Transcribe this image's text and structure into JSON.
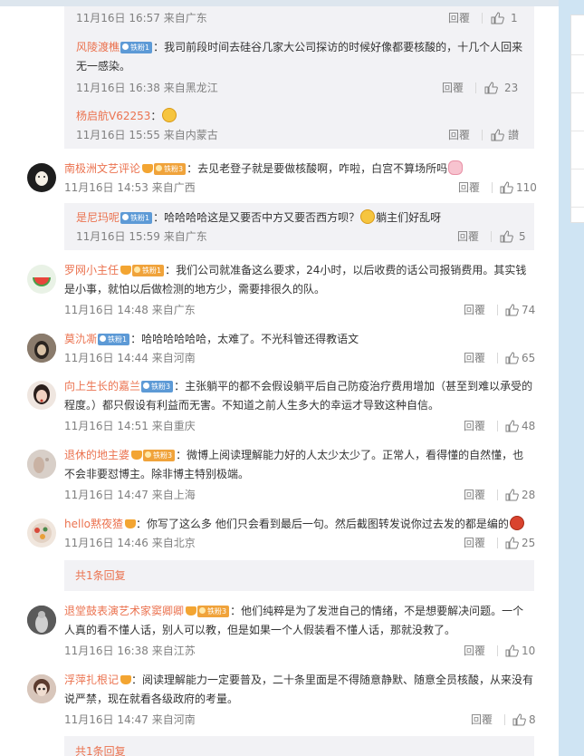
{
  "ui": {
    "reply_label": "回覆",
    "expand_label": "共1条回复",
    "colors": {
      "username": "#eb7350",
      "meta": "#808080",
      "sub_bg": "#f2f2f5",
      "page_bg": "#cfe4f3"
    }
  },
  "top_sub": {
    "row0": {
      "meta": "11月16日 16:57 来自广东",
      "likes": "1"
    },
    "row1": {
      "user": "风陵渡樵",
      "badge": "铁粉1",
      "text": "我司前段时间去硅谷几家大公司探访的时候好像都要核酸的，十几个人回来无一感染。",
      "meta": "11月16日 16:38 来自黑龙江",
      "likes": "23"
    },
    "row2": {
      "user": "杨启航V62253",
      "emoji": "thinking-emoji",
      "meta": "11月16日 15:55 来自内蒙古",
      "likes": "讃"
    }
  },
  "comments": [
    {
      "user": "南极洲文艺评论",
      "badge": "铁粉3",
      "text": "去见老登子就是要做核酸啊，咋啦，白宫不算场所吗",
      "emoji": "pig-emoji",
      "meta": "11月16日 14:53 来自广西",
      "likes": "110",
      "reply": {
        "user": "是尼玛呢",
        "badge": "铁粉1",
        "text": "哈哈哈哈这是又要否中方又要否西方呗？",
        "text2": "躺主们好乱呀",
        "emoji": "cat-emoji",
        "meta": "11月16日 15:59 来自广东",
        "likes": "5"
      }
    },
    {
      "user": "罗网小主任",
      "badge": "铁粉1",
      "text": "我们公司就准备这么要求，24小时，以后收费的话公司报销费用。其实钱是小事，就怕以后做检测的地方少，需要排很久的队。",
      "meta": "11月16日 14:48 来自广东",
      "likes": "74"
    },
    {
      "user": "莫氿凘",
      "badge": "铁粉1",
      "text": "哈哈哈哈哈哈，太难了。不光科管还得教语文",
      "meta": "11月16日 14:44 来自河南",
      "likes": "65"
    },
    {
      "user": "向上生长的嘉兰",
      "badge": "铁粉3",
      "text": "主张躺平的都不会假设躺平后自己防疫治疗费用增加（甚至到难以承受的程度。）都只假设有利益而无害。不知道之前人生多大的幸运才导致这种自信。",
      "meta": "11月16日 14:51 来自重庆",
      "likes": "48"
    },
    {
      "user": "退休的地主婆",
      "badge": "铁粉3",
      "text": "微博上阅读理解能力好的人太少太少了。正常人，看得懂的自然懂，也不会非要怼博主。除非博主特别极端。",
      "meta": "11月16日 14:47 来自上海",
      "likes": "28"
    },
    {
      "user": "hello黙夜猹",
      "text": "你写了这么多 他们只会看到最后一句。然后截图转发说你过去发的都是编的",
      "emoji": "red-emoji",
      "meta": "11月16日 14:46 来自北京",
      "likes": "25"
    },
    {
      "user": "退堂鼓表演艺术家窦卿卿",
      "badge": "铁粉3",
      "text": "他们纯粹是为了发泄自己的情绪，不是想要解决问题。一个人真的看不懂人话，别人可以教，但是如果一个人假装看不懂人话，那就没救了。",
      "meta": "11月16日 16:38 来自江苏",
      "likes": "10"
    },
    {
      "user": "浮萍扎根记",
      "text": "阅读理解能力一定要普及，二十条里面是不得随意静默、随意全员核酸，从来没有说严禁，现在就看各级政府的考量。",
      "meta": "11月16日 14:47 来自河南",
      "likes": "8"
    }
  ]
}
